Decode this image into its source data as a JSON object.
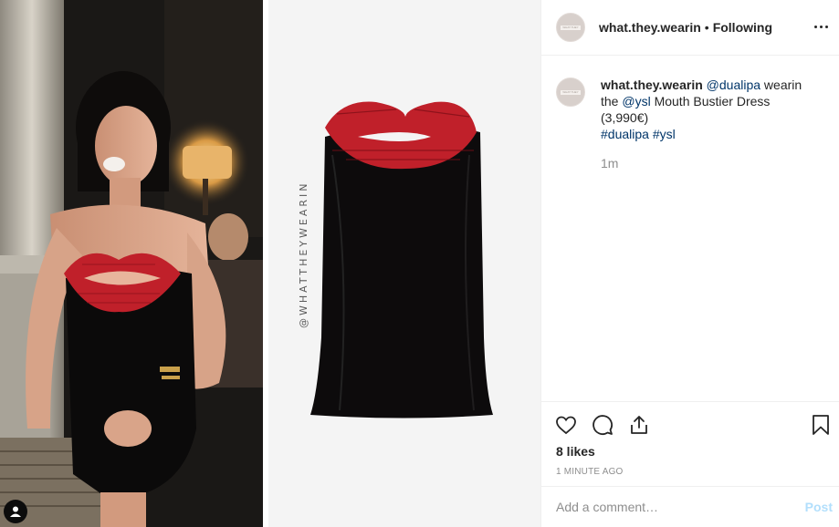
{
  "post": {
    "account": {
      "username": "what.they.wearin",
      "separator": "•",
      "follow_status": "Following",
      "avatar_text": "WHAT THEY"
    },
    "caption": {
      "username": "what.they.wearin",
      "mention_1": "@dualipa",
      "text_1": " wearin the ",
      "mention_2": "@ysl",
      "text_2": " Mouth Bustier Dress (3,990€)",
      "hashtag_1": "#dualipa",
      "hashtag_2": "#ysl",
      "relative_time": "1m"
    },
    "media": {
      "watermark": "@WHATTHEYWEARIN",
      "icons": [
        "user-tag-icon"
      ]
    },
    "actions": {
      "icons": [
        "heart-icon",
        "comment-icon",
        "share-icon",
        "bookmark-icon"
      ],
      "likes": "8 likes",
      "timestamp": "1 MINUTE AGO"
    },
    "comment": {
      "placeholder": "Add a comment…",
      "post_label": "Post"
    },
    "colors": {
      "link": "#003569",
      "post_button_disabled": "#b2dffc",
      "secondary_text": "#8e8e8e",
      "border": "#efefef",
      "lips_red": "#c0202a"
    }
  }
}
